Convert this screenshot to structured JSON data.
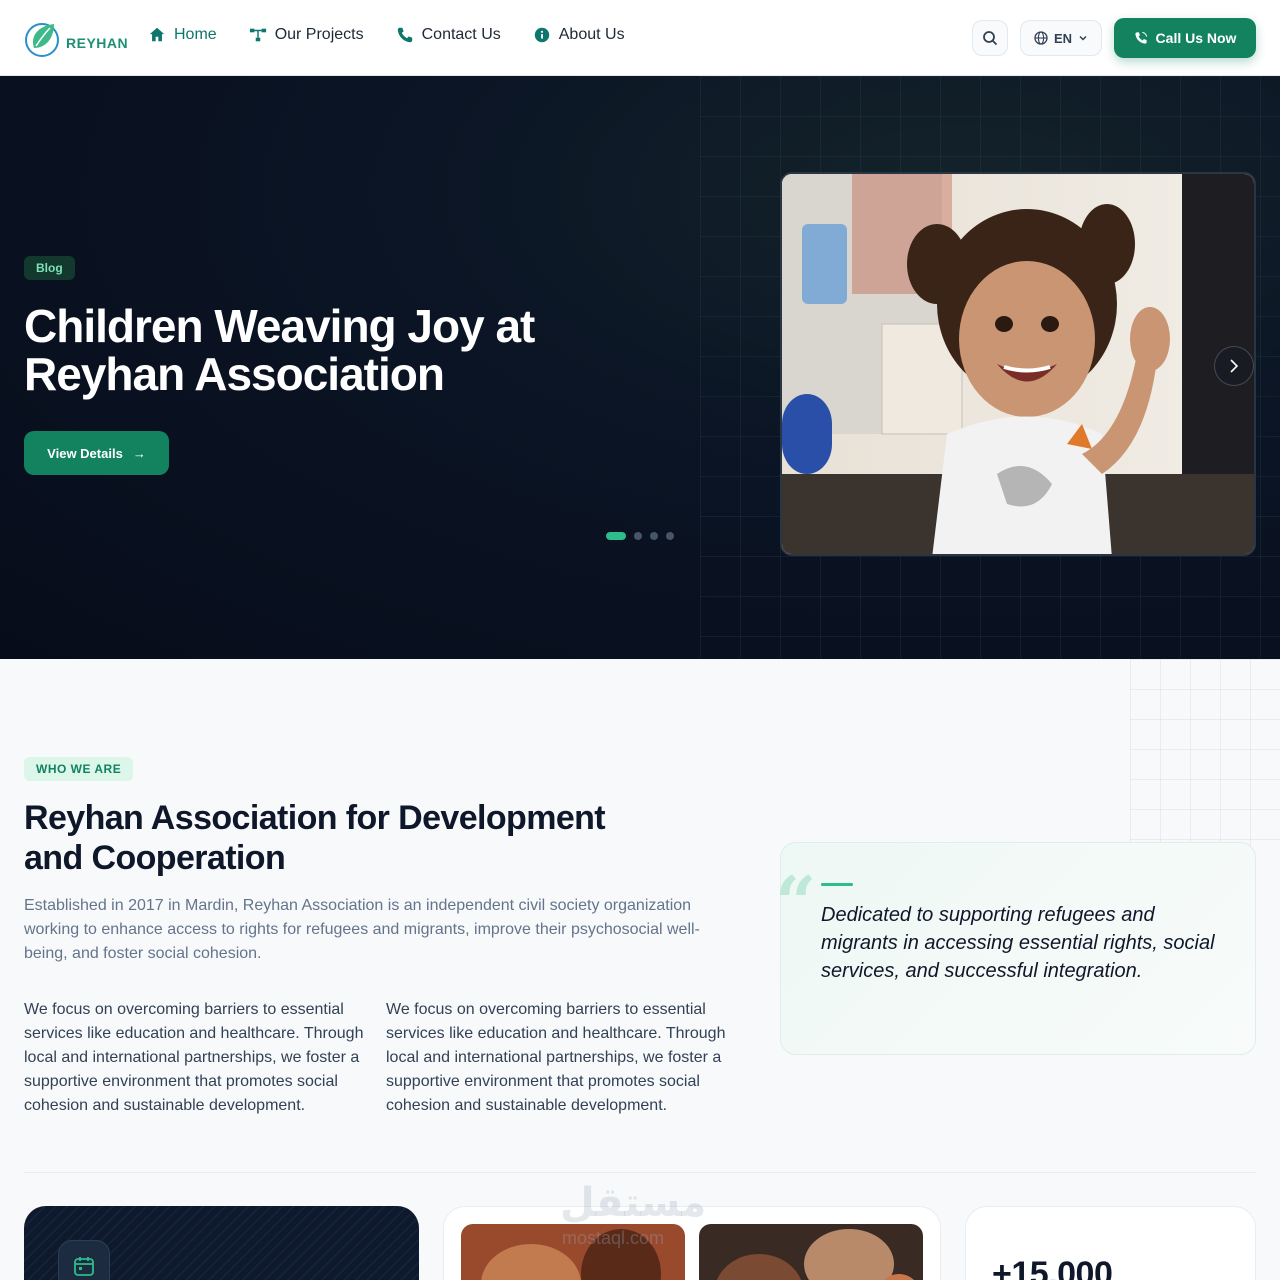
{
  "header": {
    "logo_text": "REYHAN",
    "nav": [
      {
        "label": "Home",
        "icon": "home-icon"
      },
      {
        "label": "Our Projects",
        "icon": "projects-icon"
      },
      {
        "label": "Contact Us",
        "icon": "phone-icon"
      },
      {
        "label": "About Us",
        "icon": "info-icon"
      }
    ],
    "lang": "EN",
    "call_label": "Call Us Now"
  },
  "hero": {
    "badge": "Blog",
    "title_line1": "Children Weaving Joy at",
    "title_line2": "Reyhan Association",
    "button_label": "View Details",
    "button_arrow": "→",
    "slides_total": 4,
    "slide_active": 1
  },
  "about": {
    "badge": "WHO WE ARE",
    "title_line1": "Reyhan Association for Development",
    "title_line2": "and Cooperation",
    "lead": "Established in 2017 in Mardin, Reyhan Association is an independent civil society organization working to enhance access to rights for refugees and migrants, improve their psychosocial well-being, and foster social cohesion.",
    "col1": "We focus on overcoming barriers to essential services like education and healthcare. Through local and international partnerships, we foster a supportive environment that promotes social cohesion and sustainable development.",
    "col2": "We focus on overcoming barriers to essential services like education and healthcare. Through local and international partnerships, we foster a supportive environment that promotes social cohesion and sustainable development.",
    "quote": "Dedicated to supporting refugees and migrants in accessing essential rights, social services, and successful integration."
  },
  "stats": {
    "number": "+15,000"
  },
  "watermark": {
    "text": "مستقل",
    "sub": "mostaql.com"
  },
  "colors": {
    "brand": "#13835f",
    "accent": "#2dbd8a",
    "hero_bg": "#0b1525"
  }
}
